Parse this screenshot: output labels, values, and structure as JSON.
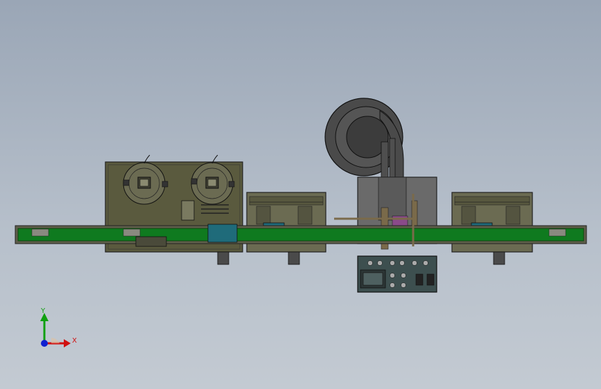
{
  "viewport": {
    "background_top": "#9aa6b6",
    "background_bottom": "#c3cad2"
  },
  "model": {
    "conveyor_color": "#0f7a1f",
    "frame_color": "#5a5a3e",
    "module_color": "#6b6b52",
    "part_color": "#1f6b7a",
    "feeder_color": "#4a4a4a",
    "panel_color": "#3d4f4f"
  },
  "triad": {
    "x_label": "X",
    "y_label": "Y",
    "x_color": "#d01010",
    "y_color": "#10a010",
    "z_color": "#1020d0"
  }
}
